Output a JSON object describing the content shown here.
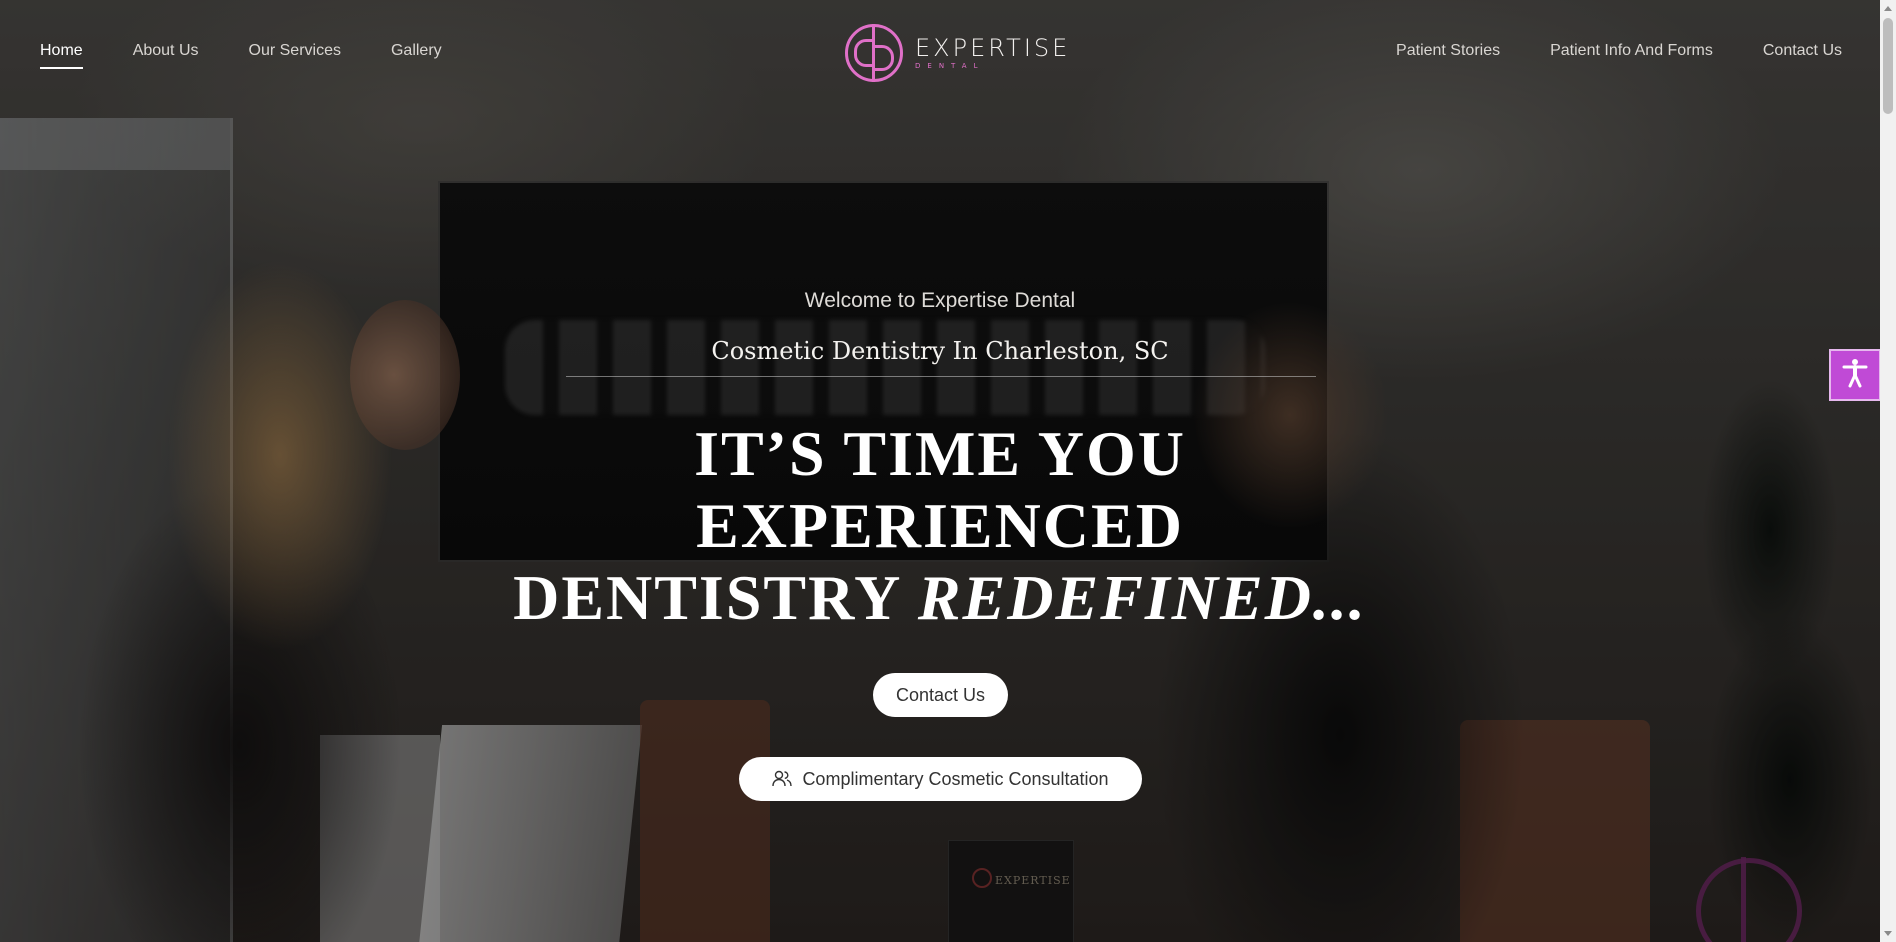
{
  "nav_left": [
    {
      "label": "Home",
      "active": true
    },
    {
      "label": "About Us"
    },
    {
      "label": "Our Services"
    },
    {
      "label": "Gallery"
    }
  ],
  "nav_right": [
    {
      "label": "Patient Stories"
    },
    {
      "label": "Patient Info And Forms"
    },
    {
      "label": "Contact Us"
    }
  ],
  "logo": {
    "name": "EXPERTISE",
    "sub": "DENTAL",
    "brand_color": "#e070c8"
  },
  "hero": {
    "welcome": "Welcome to Expertise Dental",
    "tagline": "Cosmetic Dentistry In Charleston, SC",
    "headline_line1": "IT’S TIME YOU",
    "headline_line2": "EXPERIENCED",
    "headline_line3_normal": "DENTISTRY ",
    "headline_line3_italic": "REDEFINED...",
    "contact_button": "Contact Us",
    "consult_button": "Complimentary Cosmetic Consultation",
    "consult_icon": "users-icon"
  },
  "background_photo": {
    "box_label": "EXPERTISE"
  },
  "accessibility": {
    "icon": "accessibility-person-icon",
    "color": "#c04ad6"
  }
}
